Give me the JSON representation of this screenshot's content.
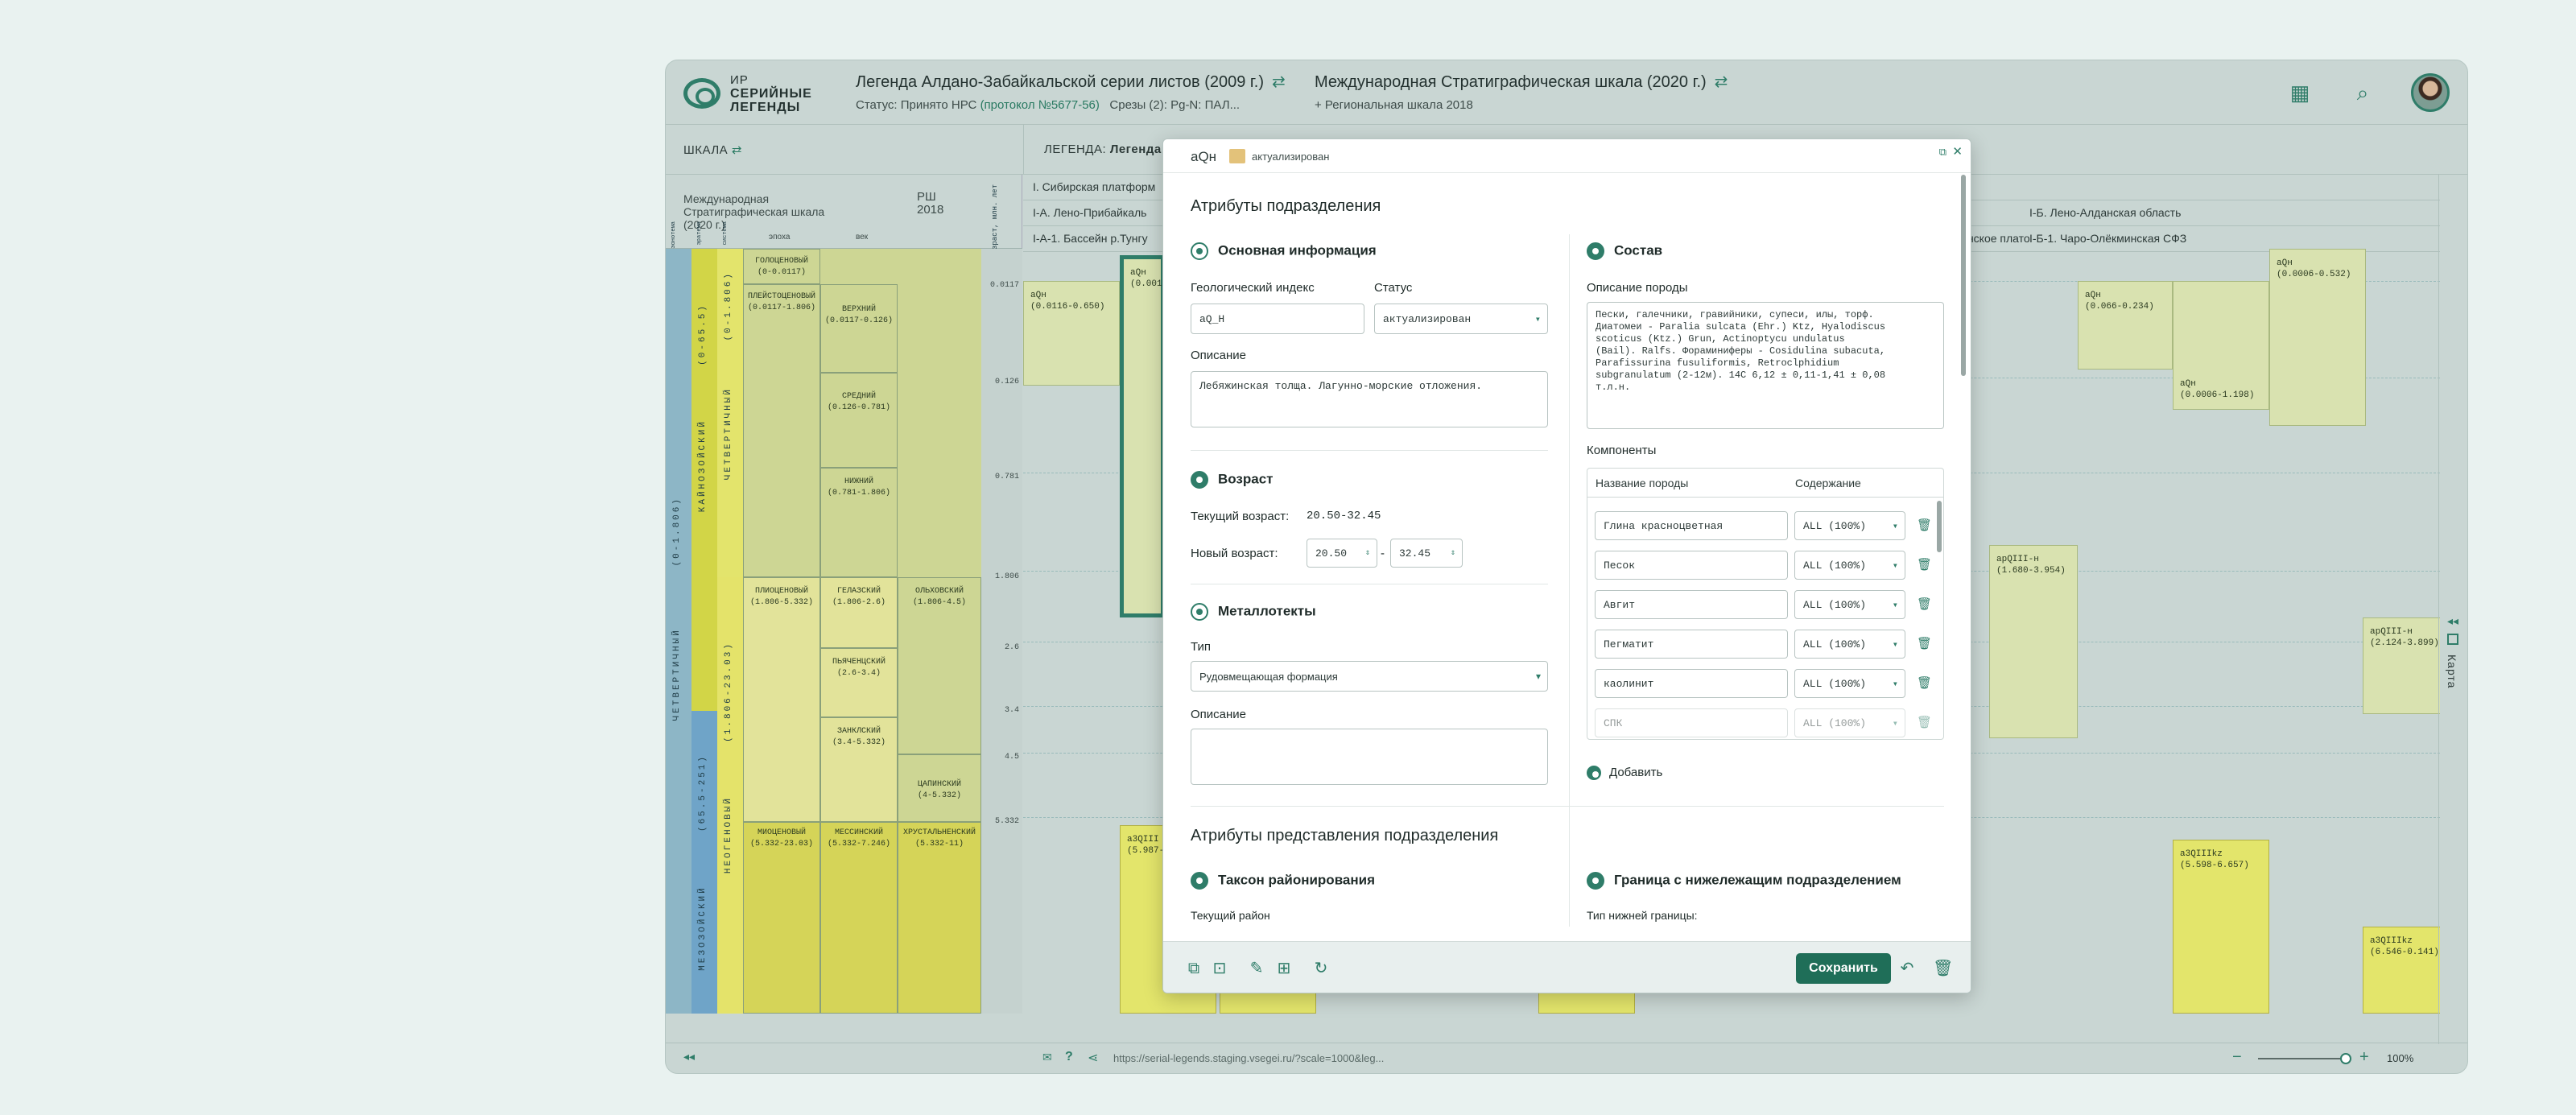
{
  "header": {
    "logo_lines": [
      "ИР",
      "СЕРИЙНЫЕ",
      "ЛЕГЕНДЫ"
    ],
    "legend_title": "Легенда Алдано-Забайкальской серии листов (2009 г.)",
    "status_label": "Статус:",
    "status_value": "Принято НРС",
    "protocol": "(протокол №5677-56)",
    "slices_label": "Срезы (2):",
    "slices_value": "Pg-N: ПАЛ...",
    "scale_title": "Международная Стратиграфическая шкала (2020 г.)",
    "scale_sub": "+ Региональная шкала 2018"
  },
  "toolbar": {
    "scale_label": "ШКАЛА",
    "legend_label": "ЛЕГЕНДА:",
    "legend_value": "Легенда А",
    "map_label": "Карта"
  },
  "scale_header": {
    "intl": "Международная Стратиграфическая шкала (2020 г.)",
    "rsh": "РШ 2018",
    "age": "Возраст, млн. лет",
    "cols": [
      "эонотема",
      "эратема",
      "система",
      "отдел",
      "эпоха",
      "век"
    ],
    "epoch": "эпоха",
    "century": "век"
  },
  "scale_eras": {
    "quat_long": "ЧЕТВЕРТИЧНЫЙ",
    "quat_long_age": "(0-1.806)",
    "cenozoic": "КАЙНОЗОЙСКИЙ",
    "cenozoic_age": "(0-65.5)",
    "quat": "ЧЕТВЕРТИЧНЫЙ",
    "quat_age": "(0-1.806)",
    "mesozoic": "МЕЗОЗОЙСКИЙ",
    "mesozoic_age": "(65.5-251)",
    "neogene": "НЕОГЕНОВЫЙ",
    "neogene_age": "(1.806-23.03)"
  },
  "scale_cells": [
    {
      "name": "ГОЛОЦЕНОВЫЙ",
      "age": "(0-0.0117)"
    },
    {
      "name": "ПЛЕЙСТОЦЕНОВЫЙ",
      "age": "(0.0117-1.806)"
    },
    {
      "name": "ВЕРХНИЙ",
      "age": "(0.0117-0.126)"
    },
    {
      "name": "СРЕДНИЙ",
      "age": "(0.126-0.781)"
    },
    {
      "name": "НИЖНИЙ",
      "age": "(0.781-1.806)"
    },
    {
      "name": "ПЛИОЦЕНОВЫЙ",
      "age": "(1.806-5.332)"
    },
    {
      "name": "ГЕЛАЗСКИЙ",
      "age": "(1.806-2.6)"
    },
    {
      "name": "ОЛЬХОВСКИЙ",
      "age": "(1.806-4.5)"
    },
    {
      "name": "ПЬЯЧЕНЦСКИЙ",
      "age": "(2.6-3.4)"
    },
    {
      "name": "ЗАНКЛСКИЙ",
      "age": "(3.4-5.332)"
    },
    {
      "name": "ЦАПИНСКИЙ",
      "age": "(4-5.332)"
    },
    {
      "name": "МИОЦЕНОВЫЙ",
      "age": "(5.332-23.03)"
    },
    {
      "name": "МЕССИНСКИЙ",
      "age": "(5.332-7.246)"
    },
    {
      "name": "ХРУСТАЛЬНЕНСКИЙ",
      "age": "(5.332-11)"
    }
  ],
  "age_ticks": [
    "0.0117",
    "0.126",
    "0.781",
    "1.806",
    "2.6",
    "3.4",
    "4.5",
    "5.332"
  ],
  "legend_rows": {
    "r1": "I. Сибирская платформ",
    "r2": "I-А. Лено-Прибайкаль",
    "r3": "I-А-1. Бассейн р.Тунгу",
    "r2b": "I-Б. Лено-Алданская область",
    "r3a": "сое и Лено-Алданское плато",
    "r3b": "I-Б-1. Чаро-Олёкминская СФЗ"
  },
  "legend_blocks": [
    {
      "code": "aQн",
      "age": "(0.0116-0.650)"
    },
    {
      "code": "aQн",
      "age": "(0.001"
    },
    {
      "code": "aQн",
      "age": "(0.066-0.234)"
    },
    {
      "code": "aQн",
      "age": "(0.0006-1.198)"
    },
    {
      "code": "aQн",
      "age": "(0.0006-0.532)"
    },
    {
      "code": "apQIII-н",
      "age": "(1.680-3.954)"
    },
    {
      "code": "apQIII-н",
      "age": "(2.124-3.899)"
    },
    {
      "code": "a3QIII",
      "age": "(5.987-"
    },
    {
      "code": "a3QIIIkz",
      "age": "(5.598-6.657)"
    },
    {
      "code": "a3QIIIkz",
      "age": "(6.546-0.141)"
    }
  ],
  "footer": {
    "url": "https://serial-legends.staging.vsegei.ru/?scale=1000&leg...",
    "zoom": "100%"
  },
  "modal": {
    "index": "aQн",
    "badge": "актуализирован",
    "title": "Атрибуты подразделения",
    "basic": {
      "title": "Основная информация",
      "index_label": "Геологический индекс",
      "index_value": "aQ_H",
      "status_label": "Статус",
      "status_value": "актуализирован",
      "desc_label": "Описание",
      "desc_value": "Лебяжинская толща. Лагунно-морские отложения."
    },
    "age": {
      "title": "Возраст",
      "current_label": "Текущий возраст:",
      "current_value": "20.50-32.45",
      "new_label": "Новый возраст:",
      "new_from": "20.50",
      "new_to": "32.45",
      "sep": "-"
    },
    "metal": {
      "title": "Металлотекты",
      "type_label": "Тип",
      "type_value": "Рудовмещающая формация",
      "desc_label": "Описание"
    },
    "composition": {
      "title": "Состав",
      "rock_desc_label": "Описание породы",
      "rock_desc": "Пески, галечники, гравийники, супеси, илы, торф.\nДиатомеи - Paralia sulcata (Ehr.) Ktz, Hyalodiscus\nscoticus (Ktz.) Grun, Actinoptycu undulatus\n(Bail). Ralfs. Фораминиферы - Cosidulina subacuta,\nParafissurina fusuliformis, Retroclphidium\nsubgranulatum (2-12м). 14С 6,12 ± 0,11-1,41 ± 0,08\nт.л.н.",
      "components_label": "Компоненты",
      "col_name": "Название породы",
      "col_content": "Содержание",
      "rows": [
        {
          "name": "Глина красноцветная",
          "content": "ALL (100%)"
        },
        {
          "name": "Песок",
          "content": "ALL (100%)"
        },
        {
          "name": "Авгит",
          "content": "ALL (100%)"
        },
        {
          "name": "Пегматит",
          "content": "ALL (100%)"
        },
        {
          "name": "каолинит",
          "content": "ALL (100%)"
        },
        {
          "name": "СПК",
          "content": "ALL (100%)"
        }
      ],
      "add_label": "Добавить"
    },
    "repr": {
      "title": "Атрибуты представления подразделения",
      "taxon_title": "Таксон районирования",
      "current_region": "Текущий район",
      "boundary_title": "Граница с нижележащим подразделением",
      "boundary_type": "Тип нижней границы:"
    },
    "save_label": "Сохранить"
  },
  "colors": {
    "accent": "#2f7d69",
    "save": "#1f6e58",
    "badge": "#e3c27a"
  }
}
